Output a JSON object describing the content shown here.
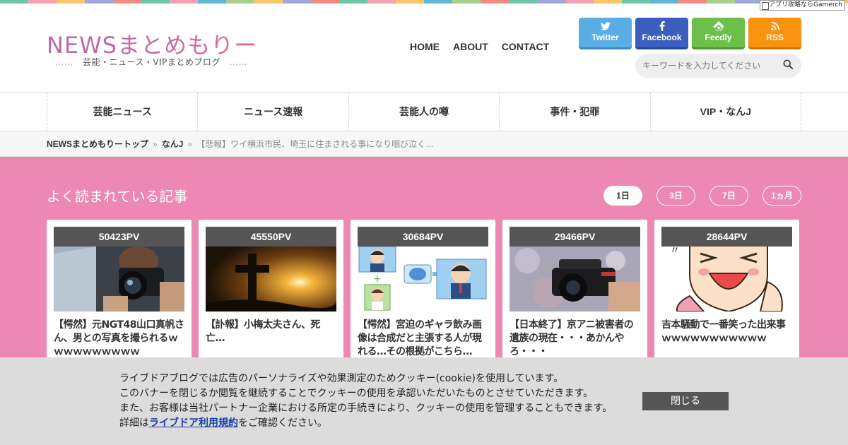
{
  "stripe_colors": [
    "#6ec6a6",
    "#f4a0b4",
    "#f7c86a",
    "#9fa8da",
    "#f28b82",
    "#6ec6a6",
    "#f4a0b4",
    "#5fb7d5",
    "#a8d08d",
    "#f7c86a",
    "#9fa8da",
    "#f28b82",
    "#6ec6a6",
    "#f4a0b4",
    "#f7c86a",
    "#5fb7d5",
    "#a8d08d",
    "#f28b82",
    "#6ec6a6",
    "#9fa8da",
    "#f4a0b4",
    "#f7c86a",
    "#6ec6a6",
    "#5fb7d5",
    "#f28b82",
    "#a8d08d",
    "#9fa8da",
    "#f4a0b4",
    "#6ec6a6",
    "#f7c86a"
  ],
  "ad_badge": "アプリ攻略ならGamerch",
  "site": {
    "logo": "NEWSまとめもりー",
    "tagline_dots": "……",
    "tagline": "芸能・ニュース・VIPまとめブログ"
  },
  "topnav": [
    "HOME",
    "ABOUT",
    "CONTACT"
  ],
  "social": [
    {
      "label": "Twitter",
      "icon": "twitter-icon"
    },
    {
      "label": "Facebook",
      "icon": "facebook-icon"
    },
    {
      "label": "Feedly",
      "icon": "feedly-icon"
    },
    {
      "label": "RSS",
      "icon": "rss-icon"
    }
  ],
  "search": {
    "placeholder": "キーワードを入力してください"
  },
  "categories": [
    "芸能ニュース",
    "ニュース速報",
    "芸能人の噂",
    "事件・犯罪",
    "VIP・なんJ"
  ],
  "breadcrumb": {
    "home": "NEWSまとめもりートップ",
    "category": "なんJ",
    "current": "【悲報】ワイ横浜市民、埼玉に住まされる事になり咽び泣く…",
    "sep": "»"
  },
  "popular": {
    "title": "よく読まれている記事",
    "tabs": [
      "1日",
      "3日",
      "7日",
      "1ヵ月"
    ],
    "active_tab": 0,
    "articles": [
      {
        "pv": "50423PV",
        "title": "【愕然】元NGT48山口真帆さん、男との写真を撮られるｗｗｗｗｗｗｗｗｗｗ"
      },
      {
        "pv": "45550PV",
        "title": "【訃報】小梅太夫さん、死亡…"
      },
      {
        "pv": "30684PV",
        "title": "【愕然】宮迫のギャラ飲み画像は合成だと主張する人が現れる…その根拠がこちら…"
      },
      {
        "pv": "29466PV",
        "title": "【日本終了】京アニ被害者の遺族の現在・・・あかんやろ・・・"
      },
      {
        "pv": "28644PV",
        "title": "吉本騒動で一番笑った出来事ｗｗｗｗｗｗｗｗｗｗｗ"
      }
    ]
  },
  "cookie": {
    "line1": "ライブドアブログでは広告のパーソナライズや効果測定のためクッキー(cookie)を使用しています。",
    "line2": "このバナーを閉じるか閲覧を継続することでクッキーの使用を承認いただいたものとさせていただきます。",
    "line3": "また、お客様は当社パートナー企業における所定の手続きにより、クッキーの使用を管理することもできます。",
    "line4_pre": "詳細は",
    "line4_link": "ライブドア利用規約",
    "line4_post": "をご確認ください。",
    "close": "閉じる"
  }
}
